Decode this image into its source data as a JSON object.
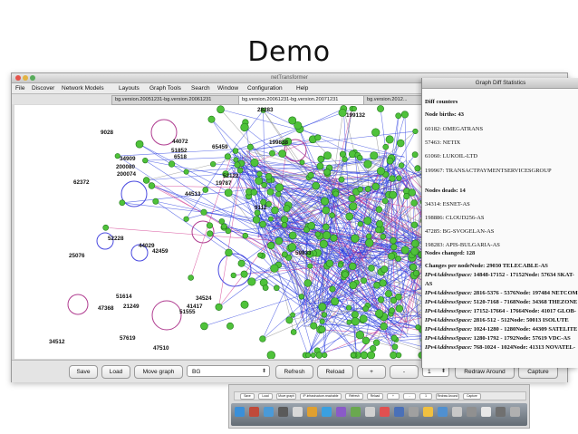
{
  "slide": {
    "title": "Demo"
  },
  "window": {
    "title": "netTransformer",
    "menu": [
      "File",
      "Discover",
      "Network Models",
      "Layouts",
      "Graph Tools",
      "Search",
      "Window",
      "Configuration",
      "Help"
    ],
    "tabs": [
      "bg.version.20051231-bg.version.20061231",
      "bg.version.20061231-bg.version.20071231",
      "bg.version.2012..."
    ],
    "node_labels": [
      "28283",
      "9028",
      "34909",
      "200080",
      "200074",
      "62372",
      "52228",
      "25076",
      "44029",
      "42459",
      "51614",
      "47368",
      "21249",
      "34512",
      "57619",
      "47510",
      "51555",
      "44513",
      "199132",
      "199838",
      "65459",
      "44072",
      "51852",
      "19787",
      "52122",
      "34524",
      "41417",
      "6518",
      "9112",
      "59833"
    ],
    "toolbar": {
      "save": "Save",
      "load": "Load",
      "move_graph": "Move graph",
      "select_value": "BG",
      "refresh": "Refresh",
      "reload": "Reload",
      "zoom_in": "+",
      "zoom_out": "-",
      "hops": "1",
      "redraw": "Redraw Around",
      "capture": "Capture"
    }
  },
  "diff_panel": {
    "title": "Graph Diff Statistics",
    "heading": "Diff counters",
    "births_label": "Node births: 43",
    "births": [
      "60182: OMEGATRANS",
      "57463: NETIX",
      "61060: LUKOIL-LTD",
      "199967: TRANSACTPAYMENTSERVICESGROUP"
    ],
    "deaths_label": "Nodes deads: 14",
    "deaths": [
      "34314: ESNET-AS",
      "198886: CLOUD256-AS",
      "47285: BG-SVOGELAN-AS",
      "198283: APIS-BULGARIA-AS"
    ],
    "changed_label": "Nodes changed: 128",
    "changes_header": "Changes per nodeNode: 29030 TELECABLE-AS",
    "changes": [
      {
        "attr": "IPv4AddressSpace:",
        "text": "14848-17152 - 17152Node: 57634 SKAT-"
      },
      {
        "attr": "",
        "text": "AS"
      },
      {
        "attr": "IPv4AddressSpace:",
        "text": "2816-5376 - 5376Node: 197484 NETCOM"
      },
      {
        "attr": "IPv4AddressSpace:",
        "text": "5120-7168 - 7168Node: 34368 THEZONE"
      },
      {
        "attr": "IPv4AddressSpace:",
        "text": "17152-17664 - 17664Node: 41017 GLOB-"
      },
      {
        "attr": "IPv4AddressSpace:",
        "text": "2816-512 - 512Node: 50013 ISOLUTE"
      },
      {
        "attr": "IPv4AddressSpace:",
        "text": "1024-1280 - 1280Node: 44309 SATELITE"
      },
      {
        "attr": "IPv4AddressSpace:",
        "text": "1280-1792 - 1792Node: 57619 VDC-AS"
      },
      {
        "attr": "IPv4AddressSpace:",
        "text": "768-1024 - 1024Node: 41313 NOVATEL-"
      }
    ]
  },
  "thumbnail": {
    "buttons": [
      "Save",
      "Load",
      "Move graph",
      "IP-infrastructure-reachable",
      "Refresh",
      "Reload",
      "+",
      "-",
      "1",
      "Redraw Around",
      "Capture"
    ]
  }
}
